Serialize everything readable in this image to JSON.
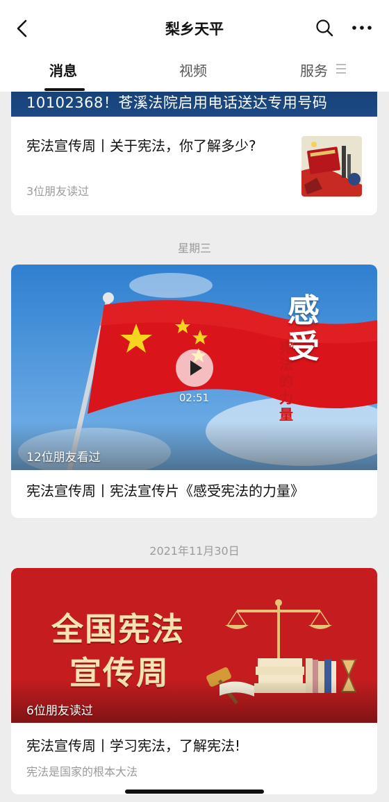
{
  "header": {
    "title": "梨乡天平",
    "back_icon": "chevron-left-icon",
    "search_icon": "search-icon",
    "more_icon": "more-horizontal-icon"
  },
  "tabs": [
    {
      "label": "消息",
      "active": true
    },
    {
      "label": "视频",
      "active": false
    },
    {
      "label": "服务",
      "active": false
    }
  ],
  "feed": {
    "card1": {
      "banner_text": "10102368！苍溪法院启用电话送达专用号码",
      "title": "宪法宣传周丨关于宪法，你了解多少?",
      "meta": "3位朋友读过"
    },
    "date1": "星期三",
    "card2": {
      "overlay_title": "感受",
      "overlay_sub": "宪法的力量",
      "duration": "02:51",
      "views": "12位朋友看过",
      "title": "宪法宣传周丨宪法宣传片《感受宪法的力量》"
    },
    "date2": "2021年11月30日",
    "card3": {
      "poster_line1": "全国宪法",
      "poster_line2": "宣传周",
      "views": "6位朋友读过",
      "title": "宪法宣传周丨学习宪法，了解宪法!",
      "subtitle": "宪法是国家的根本大法"
    }
  },
  "colors": {
    "accent_red": "#c51d1f",
    "banner_blue": "#123a6e",
    "background": "#ededed"
  }
}
